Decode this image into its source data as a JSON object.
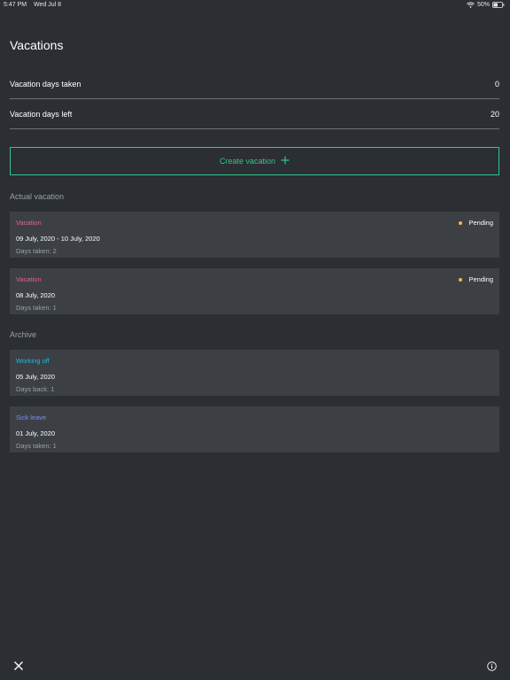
{
  "status_bar": {
    "time": "5:47 PM",
    "date": "Wed Jul 8",
    "battery": "50%"
  },
  "title": "Vacations",
  "stats": {
    "taken_label": "Vacation days taken",
    "taken_value": "0",
    "left_label": "Vacation days left",
    "left_value": "20"
  },
  "create_button": {
    "label": "Create vacation"
  },
  "actual_section": {
    "title": "Actual vacation",
    "items": [
      {
        "type": "Vacation",
        "status": "Pending",
        "dates": "09 July, 2020 - 10 July, 2020",
        "days": "Days taken: 2"
      },
      {
        "type": "Vacation",
        "status": "Pending",
        "dates": "08 July, 2020",
        "days": "Days taken: 1"
      }
    ]
  },
  "archive_section": {
    "title": "Archive",
    "items": [
      {
        "type": "Working off",
        "dates": "05 July, 2020",
        "days": "Days back: 1"
      },
      {
        "type": "Sick leave",
        "dates": "01 July, 2020",
        "days": "Days taken: 1"
      }
    ]
  },
  "colors": {
    "background": "#2b2e33",
    "card": "#3c4045",
    "accent_green": "#34c58e",
    "vacation_pink": "#e0629b",
    "working_off_cyan": "#29b6d8",
    "sick_leave_blue": "#7e8cf0",
    "pending_yellow": "#f6b73c"
  },
  "icons": {
    "close": "close-icon",
    "info": "info-icon",
    "plus": "plus-icon",
    "wifi": "wifi-icon",
    "battery": "battery-icon"
  }
}
